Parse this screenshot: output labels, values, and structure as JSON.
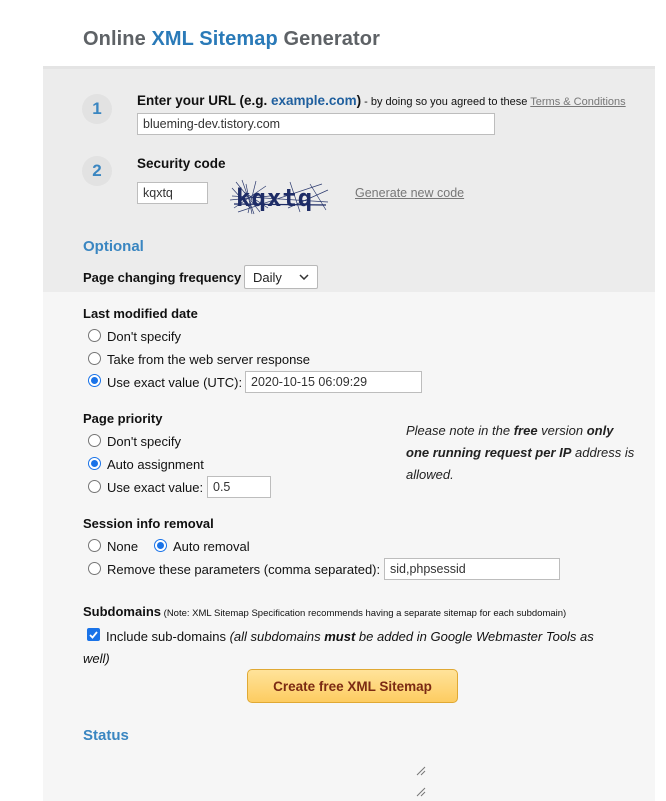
{
  "page": {
    "title_prefix": "Online ",
    "title_accent": "XML Sitemap",
    "title_suffix": " Generator"
  },
  "step1": {
    "number": "1",
    "label_pre": "Enter your URL (e.g. ",
    "label_example": "example.com",
    "label_post": ")",
    "note": " - by doing so you agreed to these ",
    "terms_link": "Terms & Conditions",
    "url_value": "blueming-dev.tistory.com"
  },
  "step2": {
    "number": "2",
    "label": "Security code",
    "code_value": "kqxtq",
    "captcha_text": "kqxtq",
    "generate_link": "Generate new code"
  },
  "optional": {
    "heading": "Optional",
    "frequency_label": "Page changing frequency",
    "frequency_selected": "Daily"
  },
  "last_modified": {
    "heading": "Last modified date",
    "options": [
      "Don't specify",
      "Take from the web server response",
      "Use exact value (UTC):"
    ],
    "selected_index": 2,
    "exact_value": "2020-10-15 06:09:29"
  },
  "priority": {
    "heading": "Page priority",
    "options": [
      "Don't specify",
      "Auto assignment",
      "Use exact value:"
    ],
    "selected_index": 1,
    "exact_value": "0.5"
  },
  "note": {
    "part1": "Please note in the ",
    "free": "free",
    "part2": " version ",
    "only": "only one running request per IP",
    "part3": " address is allowed."
  },
  "session": {
    "heading": "Session info removal",
    "option_none": "None",
    "option_auto": "Auto removal",
    "option_remove": "Remove these parameters (comma separated):",
    "selected": "auto",
    "params_value": "sid,phpsessid"
  },
  "subdomains": {
    "heading": "Subdomains",
    "heading_note": " (Note: XML Sitemap Specification recommends having a separate sitemap for each subdomain)",
    "checkbox_label": "Include sub-domains ",
    "italic_part1": "(all subdomains ",
    "italic_must": "must",
    "italic_part2": " be added in Google Webmaster Tools as well)",
    "checked": true
  },
  "actions": {
    "create_label": "Create free XML Sitemap"
  },
  "status": {
    "heading": "Status"
  },
  "colors": {
    "accent": "#2a7ab8",
    "radio_checked": "#1a73e8",
    "button_gold": "#fdcc61",
    "button_text": "#7b2a13"
  }
}
